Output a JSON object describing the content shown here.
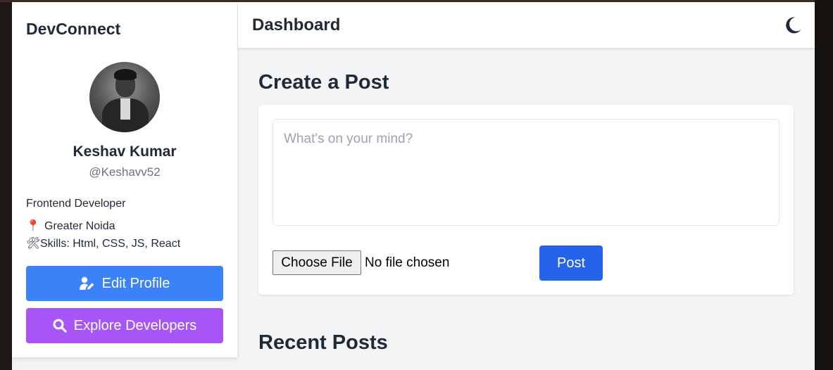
{
  "sidebar": {
    "brand": "DevConnect",
    "profile": {
      "name": "Keshav Kumar",
      "handle": "@Keshavv52",
      "role": "Frontend Developer",
      "location_icon": "📍",
      "location": "Greater Noida",
      "skills_icon": "🛠",
      "skills": "Skills: Html, CSS, JS, React"
    },
    "buttons": {
      "edit_profile": "Edit Profile",
      "explore_developers": "Explore Developers"
    }
  },
  "header": {
    "title": "Dashboard",
    "theme_toggle_icon": "moon-icon"
  },
  "create_post": {
    "heading": "Create a Post",
    "textarea_placeholder": "What's on your mind?",
    "textarea_value": "",
    "file_button": "Choose File",
    "file_status": "No file chosen",
    "submit_label": "Post"
  },
  "recent_posts": {
    "heading": "Recent Posts"
  },
  "colors": {
    "edit_button": "#3b82f6",
    "explore_button": "#a855f7",
    "post_button": "#2563eb",
    "page_background": "#f3f4f6"
  }
}
